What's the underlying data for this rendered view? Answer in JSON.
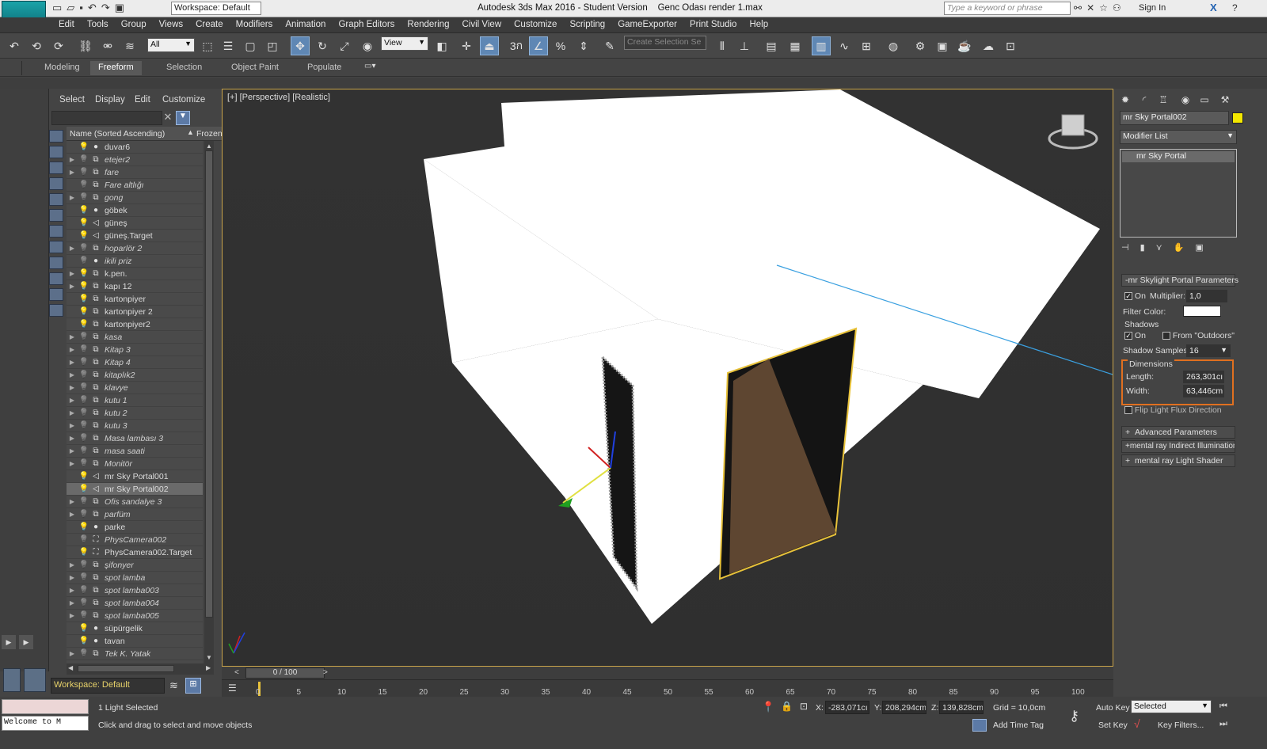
{
  "titlebar": {
    "workspace_label": "Workspace: Default",
    "title": "Autodesk 3ds Max 2016 - Student Version",
    "filename": "Genc Odası render 1.max",
    "search_placeholder": "Type a keyword or phrase",
    "sign_in": "Sign In"
  },
  "menu": [
    "Edit",
    "Tools",
    "Group",
    "Views",
    "Create",
    "Modifiers",
    "Animation",
    "Graph Editors",
    "Rendering",
    "Civil View",
    "Customize",
    "Scripting",
    "GameExporter",
    "Print Studio",
    "Help"
  ],
  "toolbar": {
    "selection_filter": "All",
    "ref_coord": "View",
    "create_selection_set": "Create Selection Se",
    "snap_3": "3"
  },
  "ribbon": {
    "tabs": [
      "Modeling",
      "Freeform",
      "Selection",
      "Object Paint",
      "Populate"
    ],
    "active": "Freeform"
  },
  "scene_explorer": {
    "menus": [
      "Select",
      "Display",
      "Edit",
      "Customize"
    ],
    "col_name": "Name (Sorted Ascending)",
    "col_frozen": "Frozen",
    "items": [
      {
        "name": "duvar6",
        "exp": false,
        "bulb": true,
        "icon": "sphere",
        "it": false,
        "sel": false
      },
      {
        "name": "etejer2",
        "exp": true,
        "bulb": false,
        "icon": "group",
        "it": true,
        "sel": false
      },
      {
        "name": "fare",
        "exp": true,
        "bulb": false,
        "icon": "group",
        "it": true,
        "sel": false
      },
      {
        "name": "Fare altlığı",
        "exp": false,
        "bulb": false,
        "icon": "group",
        "it": true,
        "sel": false
      },
      {
        "name": "gong",
        "exp": true,
        "bulb": false,
        "icon": "group",
        "it": true,
        "sel": false
      },
      {
        "name": "göbek",
        "exp": false,
        "bulb": true,
        "icon": "sphere",
        "it": false,
        "sel": false
      },
      {
        "name": "güneş",
        "exp": false,
        "bulb": true,
        "icon": "light",
        "it": false,
        "sel": false
      },
      {
        "name": "güneş.Target",
        "exp": false,
        "bulb": true,
        "icon": "light",
        "it": false,
        "sel": false
      },
      {
        "name": "hoparlör 2",
        "exp": true,
        "bulb": false,
        "icon": "group",
        "it": true,
        "sel": false
      },
      {
        "name": "ikili priz",
        "exp": false,
        "bulb": false,
        "icon": "sphere",
        "it": true,
        "sel": false
      },
      {
        "name": "k.pen.",
        "exp": true,
        "bulb": true,
        "icon": "group",
        "it": false,
        "sel": false
      },
      {
        "name": "kapı 12",
        "exp": true,
        "bulb": true,
        "icon": "group",
        "it": false,
        "sel": false
      },
      {
        "name": "kartonpiyer",
        "exp": false,
        "bulb": true,
        "icon": "group",
        "it": false,
        "sel": false
      },
      {
        "name": "kartonpiyer 2",
        "exp": false,
        "bulb": true,
        "icon": "group",
        "it": false,
        "sel": false
      },
      {
        "name": "kartonpiyer2",
        "exp": false,
        "bulb": true,
        "icon": "group",
        "it": false,
        "sel": false
      },
      {
        "name": "kasa",
        "exp": true,
        "bulb": false,
        "icon": "group",
        "it": true,
        "sel": false
      },
      {
        "name": "Kitap 3",
        "exp": true,
        "bulb": false,
        "icon": "group",
        "it": true,
        "sel": false
      },
      {
        "name": "Kitap 4",
        "exp": true,
        "bulb": false,
        "icon": "group",
        "it": true,
        "sel": false
      },
      {
        "name": "kitaplık2",
        "exp": true,
        "bulb": false,
        "icon": "group",
        "it": true,
        "sel": false
      },
      {
        "name": "klavye",
        "exp": true,
        "bulb": false,
        "icon": "group",
        "it": true,
        "sel": false
      },
      {
        "name": "kutu 1",
        "exp": true,
        "bulb": false,
        "icon": "group",
        "it": true,
        "sel": false
      },
      {
        "name": "kutu 2",
        "exp": true,
        "bulb": false,
        "icon": "group",
        "it": true,
        "sel": false
      },
      {
        "name": "kutu 3",
        "exp": true,
        "bulb": false,
        "icon": "group",
        "it": true,
        "sel": false
      },
      {
        "name": "Masa lambası 3",
        "exp": true,
        "bulb": false,
        "icon": "group",
        "it": true,
        "sel": false
      },
      {
        "name": "masa saati",
        "exp": true,
        "bulb": false,
        "icon": "group",
        "it": true,
        "sel": false
      },
      {
        "name": "Monitör",
        "exp": true,
        "bulb": false,
        "icon": "group",
        "it": true,
        "sel": false
      },
      {
        "name": "mr Sky Portal001",
        "exp": false,
        "bulb": true,
        "icon": "light",
        "it": false,
        "sel": false
      },
      {
        "name": "mr Sky Portal002",
        "exp": false,
        "bulb": true,
        "icon": "light",
        "it": false,
        "sel": true
      },
      {
        "name": "Ofis sandalye 3",
        "exp": true,
        "bulb": false,
        "icon": "group",
        "it": true,
        "sel": false
      },
      {
        "name": "parfüm",
        "exp": true,
        "bulb": false,
        "icon": "group",
        "it": true,
        "sel": false
      },
      {
        "name": "parke",
        "exp": false,
        "bulb": true,
        "icon": "sphere",
        "it": false,
        "sel": false
      },
      {
        "name": "PhysCamera002",
        "exp": false,
        "bulb": false,
        "icon": "camera",
        "it": true,
        "sel": false
      },
      {
        "name": "PhysCamera002.Target",
        "exp": false,
        "bulb": true,
        "icon": "camera",
        "it": false,
        "sel": false
      },
      {
        "name": "şifonyer",
        "exp": true,
        "bulb": false,
        "icon": "group",
        "it": true,
        "sel": false
      },
      {
        "name": "spot lamba",
        "exp": true,
        "bulb": false,
        "icon": "group",
        "it": true,
        "sel": false
      },
      {
        "name": "spot lamba003",
        "exp": true,
        "bulb": false,
        "icon": "group",
        "it": true,
        "sel": false
      },
      {
        "name": "spot lamba004",
        "exp": true,
        "bulb": false,
        "icon": "group",
        "it": true,
        "sel": false
      },
      {
        "name": "spot lamba005",
        "exp": true,
        "bulb": false,
        "icon": "group",
        "it": true,
        "sel": false
      },
      {
        "name": "süpürgelik",
        "exp": false,
        "bulb": true,
        "icon": "sphere",
        "it": false,
        "sel": false
      },
      {
        "name": "tavan",
        "exp": false,
        "bulb": true,
        "icon": "sphere",
        "it": false,
        "sel": false
      },
      {
        "name": "Tek K. Yatak",
        "exp": true,
        "bulb": false,
        "icon": "group",
        "it": true,
        "sel": false
      }
    ],
    "workspace": "Workspace: Default"
  },
  "viewport": {
    "label": "[+] [Perspective] [Realistic]"
  },
  "command_panel": {
    "object_name": "mr Sky Portal002",
    "object_color": "#f4e800",
    "modifier_list": "Modifier List",
    "stack_item": "mr Sky Portal",
    "params_title": "mr Skylight Portal Parameters",
    "on_label": "On",
    "multiplier_label": "Multiplier:",
    "multiplier_value": "1,0",
    "filter_color_label": "Filter Color:",
    "shadows_label": "Shadows",
    "shadows_on": "On",
    "from_outdoors": "From \"Outdoors\"",
    "shadow_samples_label": "Shadow Samples:",
    "shadow_samples_value": "16",
    "dimensions_label": "Dimensions",
    "length_label": "Length:",
    "length_value": "263,301cı",
    "width_label": "Width:",
    "width_value": "63,446cm",
    "flip_label": "Flip Light Flux Direction",
    "rollouts": [
      "Advanced Parameters",
      "mental ray Indirect Illumination",
      "mental ray Light Shader"
    ]
  },
  "timeline": {
    "frame": "0 / 100",
    "ticks": [
      "0",
      "5",
      "10",
      "15",
      "20",
      "25",
      "30",
      "35",
      "40",
      "45",
      "50",
      "55",
      "60",
      "65",
      "70",
      "75",
      "80",
      "85",
      "90",
      "95",
      "100"
    ]
  },
  "status": {
    "welcome": "Welcome to M",
    "selected": "1 Light Selected",
    "prompt": "Click and drag to select and move objects",
    "x_label": "X:",
    "x_value": "-283,071cı",
    "y_label": "Y:",
    "y_value": "208,294cm",
    "z_label": "Z:",
    "z_value": "139,828cm",
    "grid": "Grid = 10,0cm",
    "add_time_tag": "Add Time Tag",
    "auto_key": "Auto Key",
    "set_key": "Set Key",
    "selected_dropdown": "Selected",
    "key_filters": "Key Filters..."
  }
}
